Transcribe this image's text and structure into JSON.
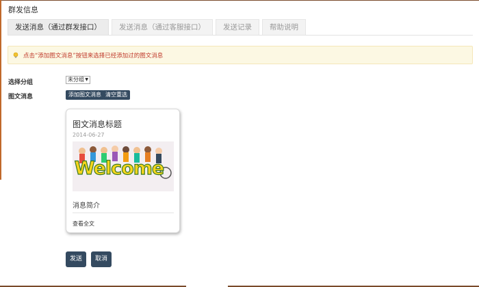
{
  "page": {
    "title": "群发信息"
  },
  "tabs": [
    {
      "label": "发送消息（通过群发接口）",
      "active": true
    },
    {
      "label": "发送消息（通过客服接口）",
      "active": false
    },
    {
      "label": "发送记录",
      "active": false
    },
    {
      "label": "帮助说明",
      "active": false
    }
  ],
  "alert": {
    "icon": "lightbulb-icon",
    "text": "点击“添加图文消息”按钮来选择已经添加过的图文消息",
    "color": "#c0392b"
  },
  "form": {
    "group_label": "选择分组",
    "group_value": "未分组",
    "news_label": "图文消息",
    "add_news_label": "添加图文消息",
    "clear_label": "清空重选"
  },
  "card": {
    "title": "图文消息标题",
    "date": "2014-06-27",
    "image_text": "Welcome",
    "summary": "消息简介",
    "read_more": "查看全文"
  },
  "actions": {
    "send_label": "发送",
    "cancel_label": "取消"
  },
  "colors": {
    "button": "#344a60",
    "alert_bg": "#fcf8e3"
  }
}
